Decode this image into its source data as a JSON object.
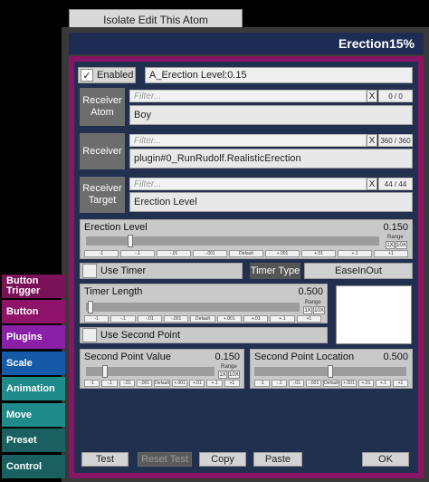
{
  "toolbar": {
    "isolate_label": "Isolate Edit This Atom"
  },
  "panel": {
    "title": "Erection15%"
  },
  "tabs": [
    {
      "label": "Button Trigger",
      "color": "#7b1258"
    },
    {
      "label": "Button",
      "color": "#8f1469"
    },
    {
      "label": "Plugins",
      "color": "#8a1fa8"
    },
    {
      "label": "Scale",
      "color": "#155aa8"
    },
    {
      "label": "Animation",
      "color": "#1f8a8a"
    },
    {
      "label": "Move",
      "color": "#1f8a8a"
    },
    {
      "label": "Preset",
      "color": "#1b6060"
    },
    {
      "label": "Control",
      "color": "#1b6060"
    }
  ],
  "enabled": {
    "label": "Enabled",
    "checked": true,
    "name_value": "A_Erection Level:0.15"
  },
  "receiver_atom": {
    "label": "Receiver Atom",
    "filter_placeholder": "Filter...",
    "count": "0 / 0",
    "value": "Boy"
  },
  "receiver": {
    "label": "Receiver",
    "filter_placeholder": "Filter...",
    "count": "360 / 360",
    "value": "plugin#0_RunRudolf.RealisticErection"
  },
  "receiver_target": {
    "label": "Receiver Target",
    "filter_placeholder": "Filter...",
    "count": "44 / 44",
    "value": "Erection Level"
  },
  "clear_label": "X",
  "range_label": "Range",
  "range_1x": "1X",
  "range_10x": "10X",
  "erection_slider": {
    "label": "Erection Level",
    "value": "0.150",
    "fraction": 0.15,
    "steps": [
      "-1",
      "-.1",
      "-.01",
      "-.001",
      "Default",
      "+.001",
      "+.01",
      "+.1",
      "+1"
    ]
  },
  "use_timer": {
    "label": "Use Timer",
    "checked": false
  },
  "timer_type": {
    "label": "Timer Type",
    "value": "EaseInOut"
  },
  "timer_length": {
    "label": "Timer Length",
    "value": "0.500",
    "fraction": 0.02,
    "steps": [
      "-1",
      "-.1",
      "-.01",
      "-.001",
      "Default",
      "+.001",
      "+.01",
      "+.1",
      "+1"
    ]
  },
  "use_second_point": {
    "label": "Use Second Point",
    "checked": false
  },
  "second_point_value": {
    "label": "Second Point Value",
    "value": "0.150",
    "fraction": 0.15,
    "steps": [
      "-1",
      "-.1",
      "-.01",
      "-.001",
      "Default",
      "+.001",
      "+.01",
      "+.1",
      "+1"
    ]
  },
  "second_point_location": {
    "label": "Second Point Location",
    "value": "0.500",
    "fraction": 0.5,
    "steps": [
      "-1",
      "-.1",
      "-.01",
      "-.001",
      "Default",
      "+.001",
      "+.01",
      "+.1",
      "+1"
    ]
  },
  "buttons": {
    "test": "Test",
    "reset_test": "Reset Test",
    "copy": "Copy",
    "paste": "Paste",
    "ok": "OK"
  }
}
